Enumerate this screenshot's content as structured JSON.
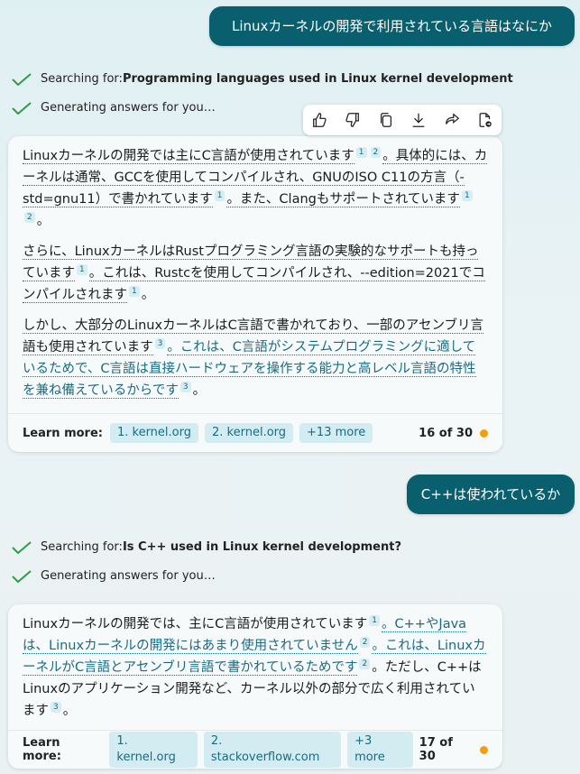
{
  "conversation": {
    "user_message_1": "Linuxカーネルの開発で利用されている言語はなにか",
    "search_1": {
      "prefix": "Searching for: ",
      "query": "Programming languages used in Linux kernel development"
    },
    "generating_1": "Generating answers for you…",
    "answer_1": {
      "p1": {
        "a": "Linuxカーネルの開発では主にC言語が使用されています",
        "c1": "1",
        "c2": "2",
        "b": "。具体的には、カーネルは通常、GCCを使用してコンパイルされ、GNUのISO C11の方言（-std=gnu11）で書かれています",
        "c3": "1",
        "c": "。また、Clangもサポートされています",
        "c4": "1",
        "c5": "2",
        "end": "。"
      },
      "p2": {
        "a": "さらに、LinuxカーネルはRustプログラミング言語の実験的なサポートも持っています",
        "c1": "1",
        "b": "。これは、Rustcを使用してコンパイルされ、--edition=2021でコンパイルされます",
        "c2": "1",
        "end": "。"
      },
      "p3": {
        "a": "しかし、大部分のLinuxカーネルはC言語で書かれており、一部のアセンブリ言語も使用されています",
        "c1": "3",
        "b": "。これは、C言語がシステムプログラミングに適しているためで、C言語は直接ハードウェアを操作する能力と高レベル言語の特性を兼ね備えているからです",
        "c2": "3",
        "end": "。"
      },
      "learn_more": {
        "label": "Learn more:",
        "links": [
          "1. kernel.org",
          "2. kernel.org",
          "+13 more"
        ],
        "count": "16 of 30"
      }
    },
    "user_message_2": "C++は使われているか",
    "search_2": {
      "prefix": "Searching for: ",
      "query": "Is C++ used in Linux kernel development?"
    },
    "generating_2": "Generating answers for you…",
    "answer_2": {
      "a": "Linuxカーネルの開発では、主にC言語が使用されています",
      "c1": "1",
      "b": "。C++やJavaは、Linuxカーネルの開発にはあまり使用されていません",
      "c2": "2",
      "c": "。これは、LinuxカーネルがC言語とアセンブリ言語で書かれているためです",
      "c3": "2",
      "d": "。ただし、C++はLinuxのアプリケーション開発など、カーネル以外の部分で広く利用されています",
      "c4": "3",
      "end": "。",
      "learn_more": {
        "label": "Learn more:",
        "links": [
          "1. kernel.org",
          "2. stackoverflow.com",
          "+3 more"
        ],
        "count": "17 of 30"
      }
    }
  },
  "toolbar": {
    "icons": [
      "thumbs-up-icon",
      "thumbs-down-icon",
      "copy-icon",
      "download-icon",
      "share-icon",
      "export-icon"
    ]
  },
  "colors": {
    "accent": "#0a5f6f",
    "link": "#1a6b82",
    "check": "#2e9e3e",
    "dot": "#f59e0b"
  }
}
